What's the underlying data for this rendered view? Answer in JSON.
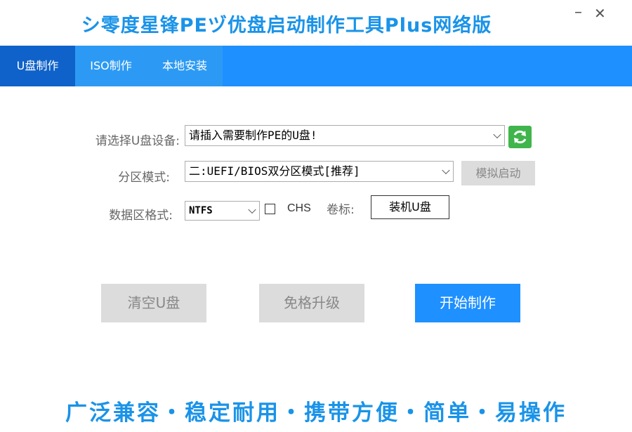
{
  "window": {
    "title": "シ零度星锋PEヅ优盘启动制作工具Plus网络版",
    "minimize_label": "–",
    "close_label": "✕"
  },
  "tabs": [
    {
      "label": "U盘制作",
      "active": true
    },
    {
      "label": "ISO制作",
      "active": false
    },
    {
      "label": "本地安装",
      "active": false
    }
  ],
  "form": {
    "device_label": "请选择U盘设备:",
    "device_value": "请插入需要制作PE的U盘!",
    "partition_label": "分区模式:",
    "partition_value": "二:UEFI/BIOS双分区模式[推荐]",
    "simulate_label": "模拟启动",
    "fs_label": "数据区格式:",
    "fs_value": "NTFS",
    "chs_label": "CHS",
    "chs_checked": false,
    "volume_label": "卷标:",
    "volume_value": "装机U盘"
  },
  "actions": {
    "clear_label": "清空U盘",
    "upgrade_label": "免格升级",
    "start_label": "开始制作"
  },
  "slogan": "广泛兼容・稳定耐用・携带方便・简单・易操作",
  "colors": {
    "accent": "#1e90ff",
    "active_tab": "#0f62c9",
    "refresh": "#3fb54b"
  }
}
